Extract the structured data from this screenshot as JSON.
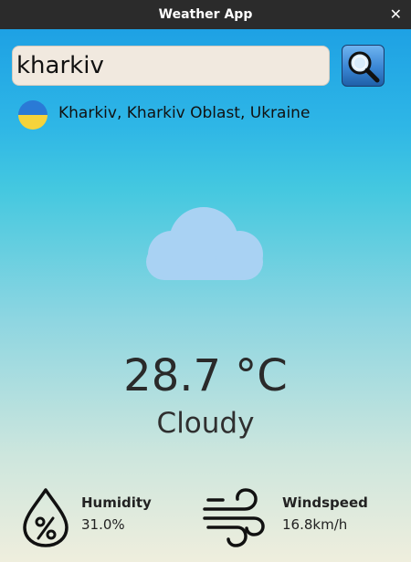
{
  "window": {
    "title": "Weather App",
    "close_glyph": "✕"
  },
  "search": {
    "value": "kharkiv",
    "button_icon": "magnifier-icon"
  },
  "location": {
    "flag_colors": [
      "#2a7ad6",
      "#f5d33b"
    ],
    "name": "Kharkiv, Kharkiv Oblast, Ukraine"
  },
  "weather": {
    "icon": "cloud-icon",
    "temperature": "28.7 °C",
    "condition": "Cloudy"
  },
  "stats": {
    "humidity": {
      "icon": "humidity-drop-icon",
      "label": "Humidity",
      "value": "31.0%"
    },
    "windspeed": {
      "icon": "wind-icon",
      "label": "Windspeed",
      "value": "16.8km/h"
    }
  }
}
